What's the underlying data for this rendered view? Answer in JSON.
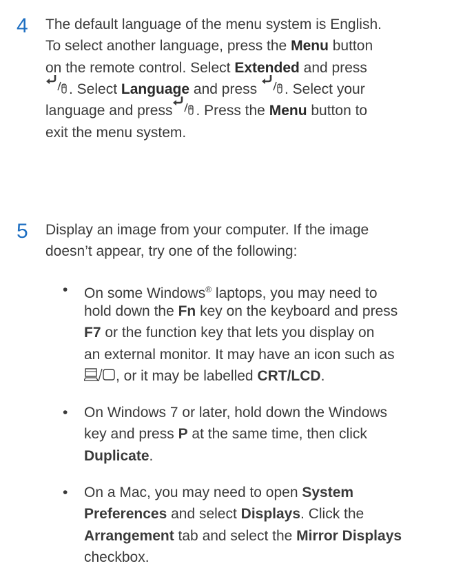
{
  "steps": [
    {
      "number": "4",
      "lines": [
        [
          "The default language of the menu system is English."
        ],
        [
          "To select another language, press the ",
          {
            "b": "Menu"
          },
          " button"
        ],
        [
          "on the remote control. Select ",
          {
            "b": "Extended"
          },
          " and press"
        ],
        [
          "{enter}",
          ". Select ",
          {
            "b": "Language"
          },
          " and press ",
          "{enter}",
          ". Select your"
        ],
        [
          "language and press",
          "{enter}",
          ". Press the ",
          {
            "b": "Menu"
          },
          " button to"
        ],
        [
          "exit the menu system."
        ]
      ]
    },
    {
      "number": "5",
      "lines": [
        [
          "Display an image from your computer. If the image"
        ],
        [
          "doesn’t appear, try one of the following:"
        ]
      ],
      "bullets": [
        {
          "lines": [
            [
              "On some Windows",
              {
                "sup": "®"
              },
              " laptops, you may need to"
            ],
            [
              "hold down the ",
              {
                "b": "Fn"
              },
              " key on the keyboard and press"
            ],
            [
              {
                "b": "F7"
              },
              " or the function key that lets you display on"
            ],
            [
              "an external monitor. It may have an icon such as"
            ],
            [
              "{monitor}",
              ", or it may be labelled ",
              {
                "b": "CRT/LCD"
              },
              "."
            ]
          ]
        },
        {
          "lines": [
            [
              "On Windows 7 or later, hold down the Windows"
            ],
            [
              "key and press ",
              {
                "b": "P"
              },
              " at the same time, then click"
            ],
            [
              {
                "b": "Duplicate"
              },
              "."
            ]
          ]
        },
        {
          "lines": [
            [
              "On a Mac, you may need to open ",
              {
                "b": "System"
              }
            ],
            [
              {
                "b": "Preferences"
              },
              " and select ",
              {
                "b": "Displays"
              },
              ". Click the"
            ],
            [
              {
                "b": "Arrangement"
              },
              " tab and select the ",
              {
                "b": "Mirror Displays"
              }
            ],
            [
              "checkbox."
            ]
          ]
        }
      ]
    }
  ],
  "bullet_char": "•",
  "icons": {
    "enter": "enter-mouse-icon",
    "monitor": "laptop-monitor-icon"
  },
  "colors": {
    "step_number": "#1e6fc2",
    "text": "#3a3a3a"
  }
}
